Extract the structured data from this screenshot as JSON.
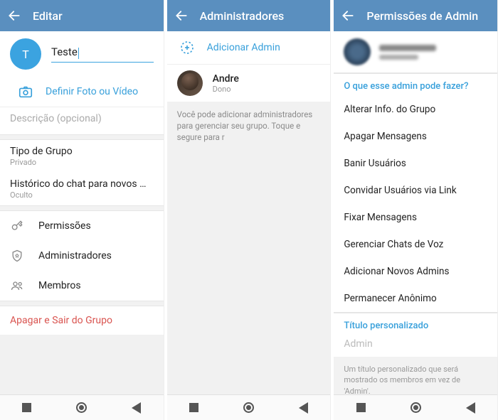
{
  "screen1": {
    "header": "Editar",
    "avatar_letter": "T",
    "name_value": "Teste",
    "set_photo": "Definir Foto ou Vídeo",
    "desc_placeholder": "Descrição (opcional)",
    "group_type_label": "Tipo de Grupo",
    "group_type_value": "Privado",
    "history_label": "Histórico do chat para novos membros",
    "history_value": "Oculto",
    "perm_label": "Permissões",
    "admin_label": "Administradores",
    "members_label": "Membros",
    "delete_label": "Apagar e Sair do Grupo"
  },
  "screen2": {
    "header": "Administradores",
    "add_label": "Adicionar Admin",
    "user_name": "Andre",
    "user_role": "Dono",
    "note": "Você pode adicionar administradores para gerenciar seu grupo. Toque e segure para r"
  },
  "screen3": {
    "header": "Permissões de Admin",
    "section_q": "O que esse admin pode fazer?",
    "perms": [
      "Alterar Info. do Grupo",
      "Apagar Mensagens",
      "Banir Usuários",
      "Convidar Usuários via Link",
      "Fixar Mensagens",
      "Gerenciar Chats de Voz",
      "Adicionar Novos Admins",
      "Permanecer Anônimo"
    ],
    "custom_title_label": "Título personalizado",
    "custom_title_value": "Admin",
    "footnote": "Um título personalizado que será mostrado os membros em vez de 'Admin'."
  }
}
